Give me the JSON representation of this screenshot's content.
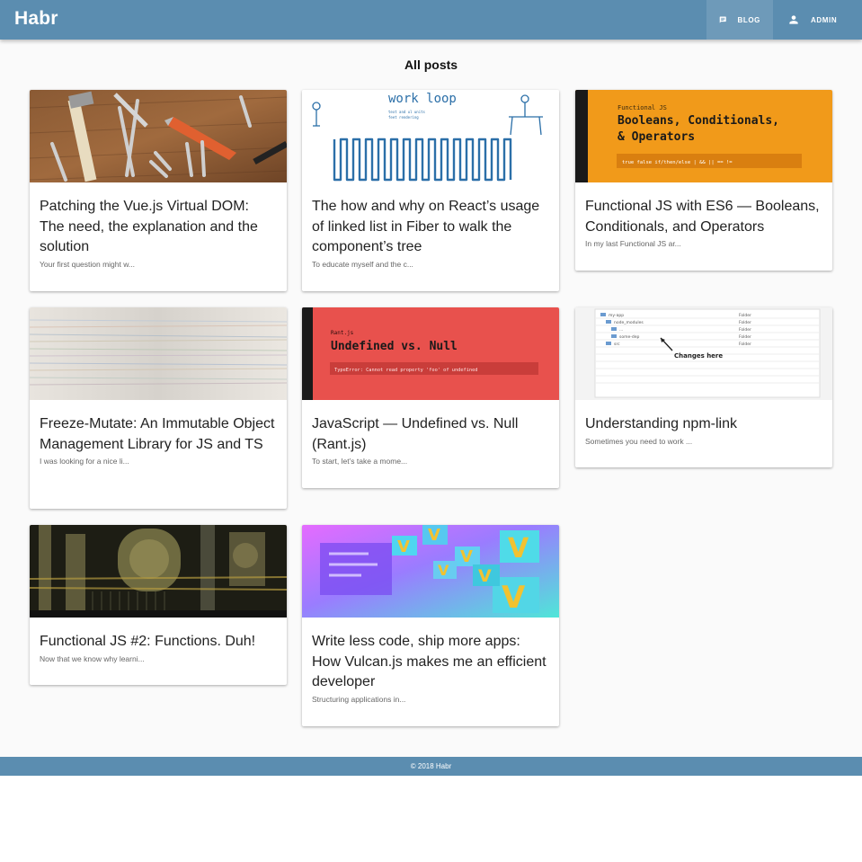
{
  "app": {
    "brand": "Habr"
  },
  "nav": {
    "blog_label": "BLOG",
    "admin_label": "ADMIN"
  },
  "page": {
    "title": "All posts"
  },
  "colors": {
    "primary": "#5b8db0",
    "background": "#fafafa"
  },
  "posts": [
    {
      "title": "Patching the Vue.js Virtual DOM: The need, the explanation and the solution",
      "excerpt": "Your first question might w..."
    },
    {
      "title": "The how and why on React’s usage of linked list in Fiber to walk the component’s tree",
      "excerpt": "To educate myself and the c...",
      "image": {
        "heading": "work loop",
        "subheading": "text and ul units\nfeet rendering"
      }
    },
    {
      "title": "Functional JS with ES6 — Booleans, Conditionals, and Operators",
      "excerpt": "In my last Functional JS ar...",
      "image": {
        "label": "Functional JS",
        "heading_line1": "Booleans, Conditionals,",
        "heading_line2": "& Operators",
        "code": "true  false  if/then/else  |  &&  ||  ==  !="
      }
    },
    {
      "title": "Freeze-Mutate: An Immutable Object Management Library for JS and TS",
      "excerpt": "I was looking for a nice li..."
    },
    {
      "title": "JavaScript — Undefined vs. Null (Rant.js)",
      "excerpt": "To start, let’s take a mome...",
      "image": {
        "label": "Rant.js",
        "heading": "Undefined vs. Null",
        "code": "TypeError: Cannot read property 'foo' of undefined"
      }
    },
    {
      "title": "Understanding npm-link",
      "excerpt": "Sometimes you need to work ...",
      "image": {
        "rows": [
          "my-app",
          "node_modules",
          "...",
          "some-dep",
          "src"
        ],
        "kind": "Folder",
        "annotation": "Changes here"
      }
    },
    {
      "title": "Functional JS #2: Functions. Duh!",
      "excerpt": "Now that we know why learni..."
    },
    {
      "title": "Write less code, ship more apps: How Vulcan.js makes me an efficient developer",
      "excerpt": "Structuring applications in..."
    }
  ],
  "footer": {
    "text": "© 2018 Habr"
  }
}
